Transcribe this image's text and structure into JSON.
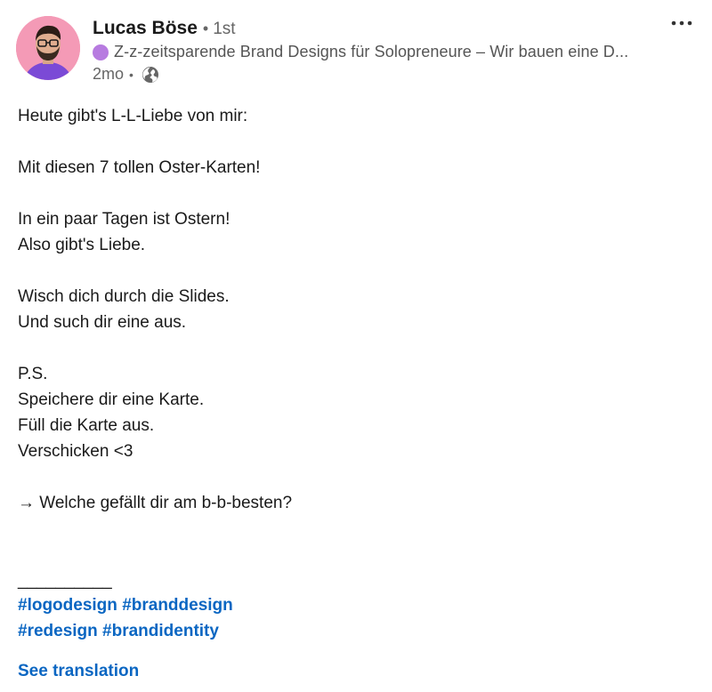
{
  "author": {
    "name": "Lucas Böse",
    "separator": "•",
    "degree": "1st",
    "headline": "Z-z-zeitsparende Brand Designs für Solopreneure – Wir bauen eine D...",
    "time": "2mo",
    "meta_separator": "•",
    "visibility_icon": "globe-icon",
    "avatar_bg": "#f49ab6"
  },
  "menu": {
    "icon": "more-horizontal-icon",
    "glyph": "•••"
  },
  "post": {
    "lines": [
      "Heute gibt's L-L-Liebe von mir:",
      "",
      "Mit diesen 7 tollen Oster-Karten!",
      "",
      "In ein paar Tagen ist Ostern!",
      "Also gibt's Liebe.",
      "",
      "Wisch dich durch die Slides.",
      "Und such dir eine aus.",
      "",
      "P.S.",
      "Speichere dir eine Karte.",
      "Füll die Karte aus.",
      "Verschicken <3",
      "",
      "→ Welche gefällt dir am b-b-besten?",
      "",
      "",
      "__________"
    ]
  },
  "hashtags": {
    "row1": [
      "#logodesign",
      "#branddesign"
    ],
    "row2": [
      "#redesign",
      "#brandidentity"
    ]
  },
  "see_translation": "See translation",
  "colors": {
    "link": "#0a66c2",
    "text": "#1a1a1a",
    "muted": "#666666",
    "headline_emoji": "#b77be0"
  }
}
